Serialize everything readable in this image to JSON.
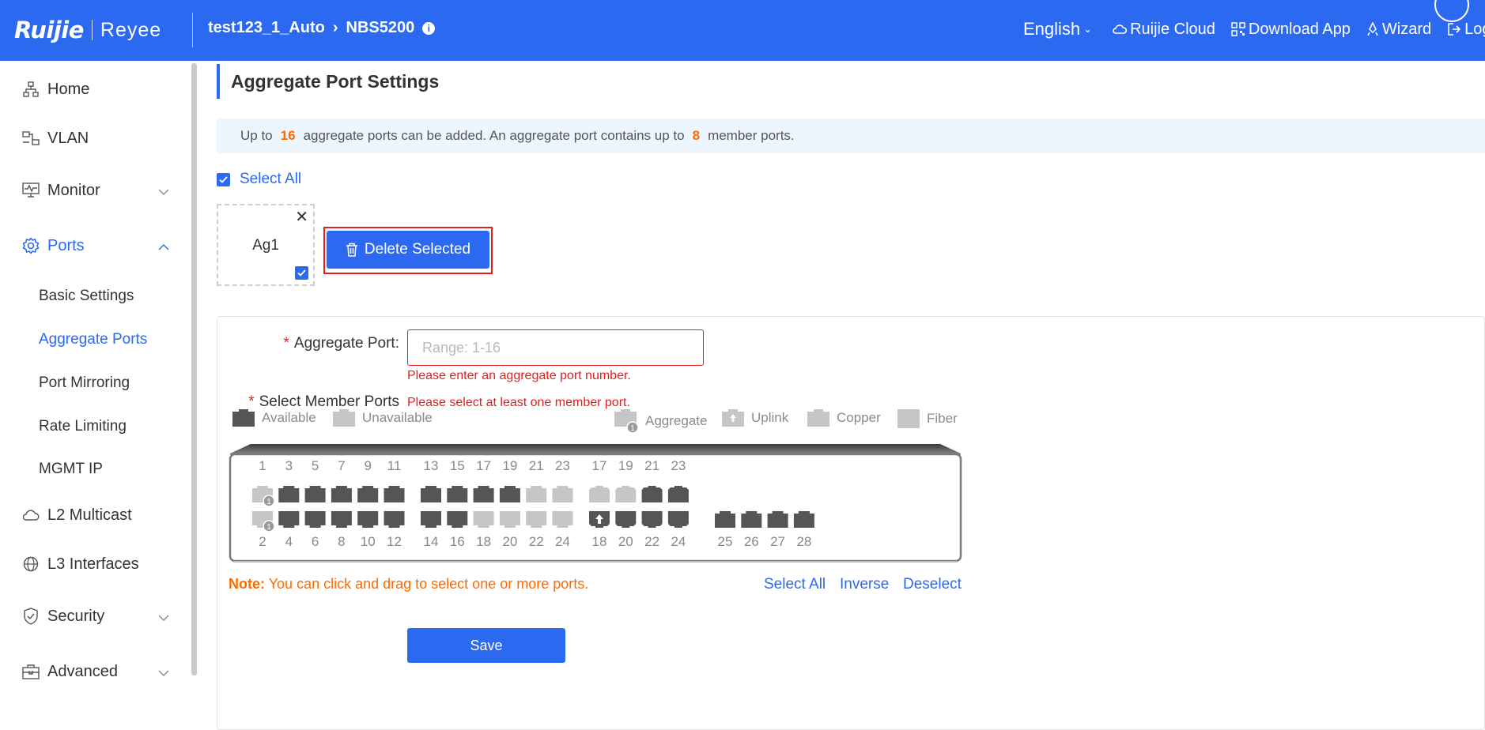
{
  "header": {
    "logo_primary": "Ruijie",
    "logo_secondary": "Reyee",
    "breadcrumb_site": "test123_1_Auto",
    "breadcrumb_device": "NBS5200",
    "language": "English",
    "cloud": "Ruijie Cloud",
    "download": "Download App",
    "wizard": "Wizard",
    "logout": "Log O"
  },
  "sidebar": {
    "items": [
      {
        "label": "Home",
        "icon": "home-tree-icon"
      },
      {
        "label": "VLAN",
        "icon": "vlan-icon"
      },
      {
        "label": "Monitor",
        "icon": "monitor-icon"
      },
      {
        "label": "Ports",
        "icon": "gear-icon"
      },
      {
        "label": "L2 Multicast",
        "icon": "cloud-icon"
      },
      {
        "label": "L3 Interfaces",
        "icon": "globe-icon"
      },
      {
        "label": "Security",
        "icon": "shield-icon"
      },
      {
        "label": "Advanced",
        "icon": "toolbox-icon"
      }
    ],
    "ports_sub": [
      "Basic Settings",
      "Aggregate Ports",
      "Port Mirroring",
      "Rate Limiting",
      "MGMT IP"
    ]
  },
  "main": {
    "title": "Aggregate Port Settings",
    "notice_a": "Up to",
    "notice_max_agg": "16",
    "notice_b": "aggregate ports can be added. An aggregate port contains up to",
    "notice_max_members": "8",
    "notice_c": "member ports.",
    "select_all": "Select All",
    "agg_card_label": "Ag1",
    "delete_selected": "Delete Selected"
  },
  "form": {
    "agg_port_label": "Aggregate Port:",
    "agg_port_placeholder": "Range: 1-16",
    "agg_port_value": "",
    "agg_port_error": "Please enter an aggregate port number.",
    "member_label": "Select Member Ports",
    "member_error": "Please select at least one member port.",
    "legend": {
      "available": "Available",
      "unavailable": "Unavailable",
      "aggregate": "Aggregate",
      "uplink": "Uplink",
      "copper": "Copper",
      "fiber": "Fiber"
    },
    "switch_groups": {
      "g1_top": [
        "1",
        "3",
        "5",
        "7",
        "9",
        "11"
      ],
      "g1_bottom": [
        "2",
        "4",
        "6",
        "8",
        "10",
        "12"
      ],
      "g2_top": [
        "13",
        "15",
        "17",
        "19",
        "21",
        "23"
      ],
      "g2_bottom": [
        "14",
        "16",
        "18",
        "20",
        "22",
        "24"
      ],
      "g3_top": [
        "17",
        "19",
        "21",
        "23"
      ],
      "g3_bottom": [
        "18",
        "20",
        "22",
        "24"
      ],
      "g4_bottom": [
        "25",
        "26",
        "27",
        "28"
      ]
    },
    "note_label": "Note:",
    "note_text": "You can click and drag to select one or more ports.",
    "link_select_all": "Select All",
    "link_inverse": "Inverse",
    "link_deselect": "Deselect",
    "save": "Save"
  },
  "colors": {
    "primary": "#2b6af0",
    "error": "#e02020",
    "accent": "#ff6a00",
    "port_available": "#555555",
    "port_unavailable": "#c6c6c6"
  }
}
